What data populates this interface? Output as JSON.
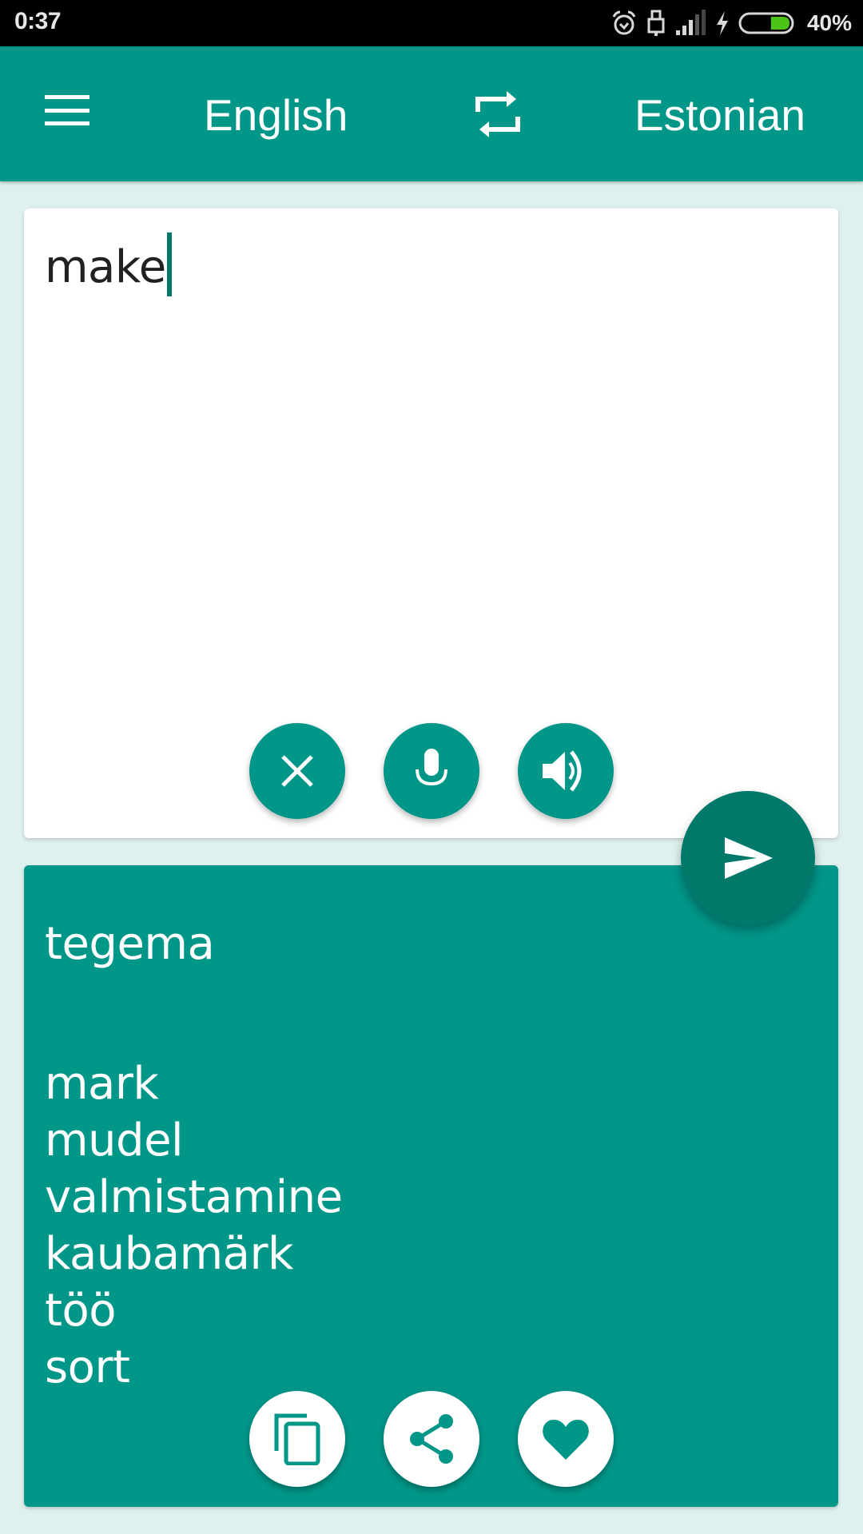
{
  "status_bar": {
    "time": "0:37",
    "icons": [
      "alarm-icon",
      "usb-debug-icon",
      "signal-icon",
      "charging-icon",
      "battery-icon"
    ],
    "battery_percent_label": "40%",
    "battery_level": 0.4,
    "battery_color": "#4cc417"
  },
  "app_bar": {
    "menu_icon": "hamburger-menu-icon",
    "source_language": "English",
    "swap_icon": "swap-languages-icon",
    "target_language": "Estonian",
    "color": "#009688"
  },
  "input": {
    "text": "make",
    "actions": [
      {
        "name": "clear",
        "icon": "close-icon"
      },
      {
        "name": "voice-input",
        "icon": "microphone-icon"
      },
      {
        "name": "speak",
        "icon": "speaker-icon"
      }
    ],
    "translate_button_icon": "send-icon"
  },
  "output": {
    "primary_translation": "tegema",
    "alternatives": [
      "mark",
      "mudel",
      "valmistamine",
      "kaubamärk",
      "töö",
      "sort"
    ],
    "actions": [
      {
        "name": "copy",
        "icon": "copy-icon"
      },
      {
        "name": "share",
        "icon": "share-icon"
      },
      {
        "name": "favorite",
        "icon": "heart-icon"
      }
    ]
  },
  "colors": {
    "primary": "#009688",
    "primary_dark": "#00796b",
    "background": "#dff1ee"
  }
}
